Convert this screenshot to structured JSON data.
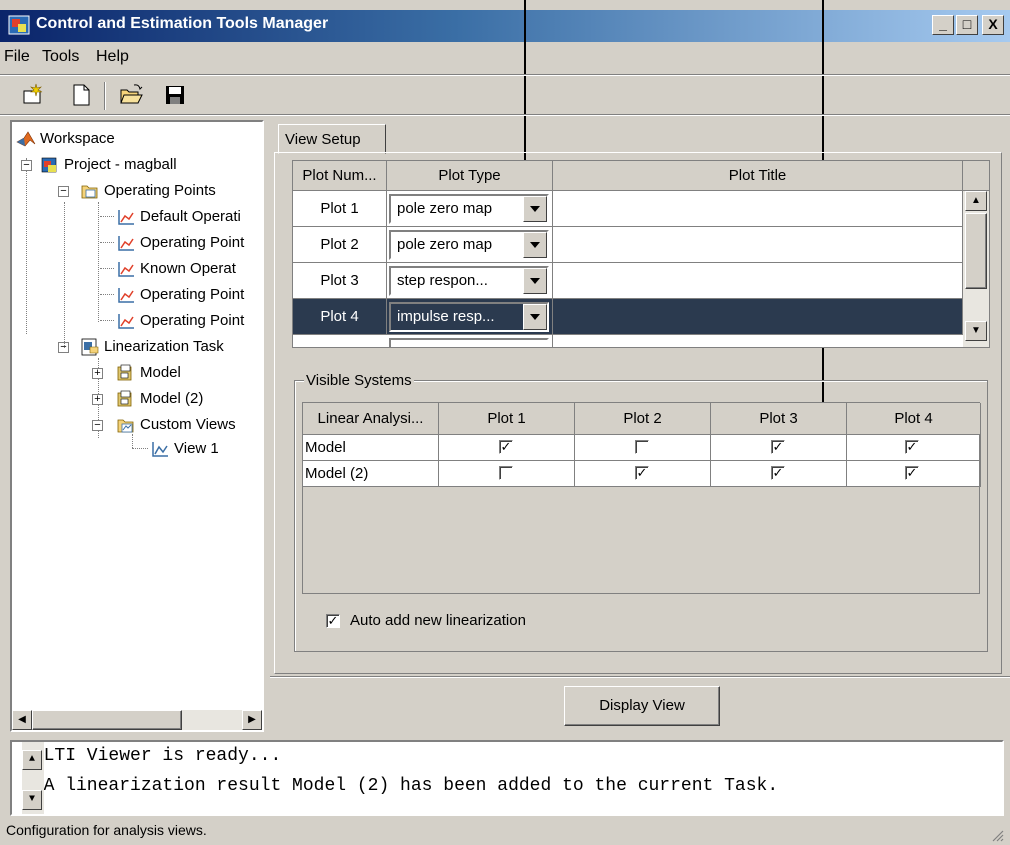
{
  "window": {
    "title": "Control and Estimation Tools Manager",
    "min": "_",
    "max": "□",
    "close": "X"
  },
  "menu": [
    "File",
    "Tools",
    "Help"
  ],
  "toolbar": [
    "new-task-icon",
    "new-document-icon",
    "open-folder-icon",
    "save-icon"
  ],
  "tree": {
    "workspace": "Workspace",
    "project": "Project - magball",
    "operating_points": "Operating Points",
    "op_children": [
      "Default Operati",
      "Operating Point",
      "Known Operat",
      "Operating Point",
      "Operating Point"
    ],
    "linearization_task": "Linearization Task",
    "model": "Model",
    "model2": "Model (2)",
    "custom_views": "Custom Views",
    "view1": "View 1"
  },
  "tab": "View Setup",
  "plot_table": {
    "headers": [
      "Plot Num...",
      "Plot Type",
      "Plot Title"
    ],
    "rows": [
      {
        "num": "Plot 1",
        "type": "pole zero map",
        "title": ""
      },
      {
        "num": "Plot 2",
        "type": "pole zero map",
        "title": ""
      },
      {
        "num": "Plot 3",
        "type": "step respon...",
        "title": ""
      },
      {
        "num": "Plot 4",
        "type": "impulse resp...",
        "title": ""
      }
    ],
    "selected_row": 3
  },
  "visible_systems": {
    "label": "Visible Systems",
    "headers": [
      "Linear Analysi...",
      "Plot 1",
      "Plot 2",
      "Plot 3",
      "Plot 4"
    ],
    "rows": [
      {
        "name": "Model",
        "checks": [
          true,
          false,
          true,
          true
        ]
      },
      {
        "name": "Model (2)",
        "checks": [
          false,
          true,
          true,
          true
        ]
      }
    ],
    "auto_add_label": "Auto add new linearization",
    "auto_add_checked": true
  },
  "display_button": "Display View",
  "console": [
    "- LTI Viewer is ready...",
    "- A linearization result Model (2) has been added to the current Task."
  ],
  "status": "Configuration for analysis views.",
  "colors": {
    "selection": "#2b3a4f",
    "title_start": "#0a246a",
    "title_end": "#a6caf0"
  }
}
